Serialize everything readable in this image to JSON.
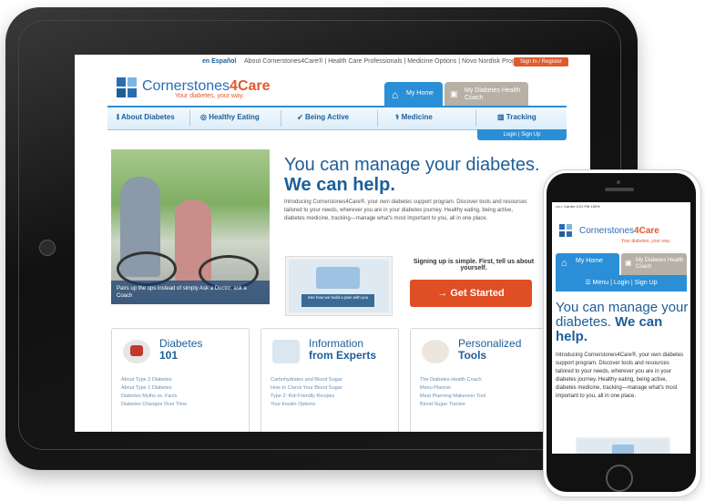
{
  "tablet": {
    "topbar": {
      "lang": "en Español",
      "links": "About Cornerstones4Care® | Health Care Professionals | Medicine Options | Novo Nordisk Programs",
      "signup": "Sign In / Register"
    },
    "logo": {
      "prefix": "Cornerstones",
      "highlight": "4Care",
      "tagline": "Your diabetes, your way."
    },
    "tabs": {
      "home": "My Home",
      "coach": "My Diabetes Health Coach"
    },
    "nav": [
      "About Diabetes",
      "Healthy Eating",
      "Being Active",
      "Medicine",
      "Tracking"
    ],
    "login_bar": "Login | Sign Up",
    "hero": {
      "title_a": "You can manage your diabetes.",
      "title_b": "We can help.",
      "body": "Introducing Cornerstones4Care®, your own diabetes support program. Discover tools and resources tailored to your needs, wherever you are in your diabetes journey. Healthy eating, being active, diabetes medicine, tracking—manage what's most important to you, all in one place.",
      "photo_caption": "Pairs up the ups instead of simply Ask a Doctor, ask a Coach",
      "video_caption": "See how we build a plan with you",
      "signup_note": "Signing up is simple. First, tell us about yourself.",
      "cta": "→  Get Started"
    },
    "cards": [
      {
        "title_a": "Diabetes",
        "title_b": "101",
        "items": [
          "About Type 2 Diabetes",
          "About Type 1 Diabetes",
          "Diabetes Myths vs. Facts",
          "Diabetes Changes Over Time"
        ]
      },
      {
        "title_a": "Information",
        "title_b": "from Experts",
        "items": [
          "Carbohydrates and Blood Sugar",
          "How to Check Your Blood Sugar",
          "Type 2: Kid-Friendly Recipes",
          "Your Insulin Options"
        ]
      },
      {
        "title_a": "Personalized",
        "title_b": "Tools",
        "items": [
          "The Diabetes Health Coach",
          "Menu Planner",
          "Meal Planning Makeover Tool",
          "Blood Sugar Tracker"
        ]
      }
    ]
  },
  "phone": {
    "status": "••••○ Carrier   4:21 PM   100%",
    "logo": {
      "prefix": "Cornerstones",
      "highlight": "4Care",
      "tagline": "Your diabetes, your way."
    },
    "tabs": {
      "home": "My Home",
      "coach": "My Diabetes Health Coach"
    },
    "menu": "☰  Menu | Login | Sign Up",
    "title_a": "You can manage your diabetes.",
    "title_b": "We can help.",
    "body": "Introducing Cornerstones4Care®, your own diabetes support program. Discover tools and resources tailored to your needs, wherever you are in your diabetes journey. Healthy eating, being active, diabetes medicine, tracking—manage what's most important to you, all in one place."
  },
  "colors": {
    "brand_blue": "#2a8fd6",
    "brand_dark": "#1d5e98",
    "accent_orange": "#e04e24",
    "logo_squares": [
      "#2a6db5",
      "#7bb6e0",
      "#1d5e98",
      "#2a6db5"
    ]
  }
}
